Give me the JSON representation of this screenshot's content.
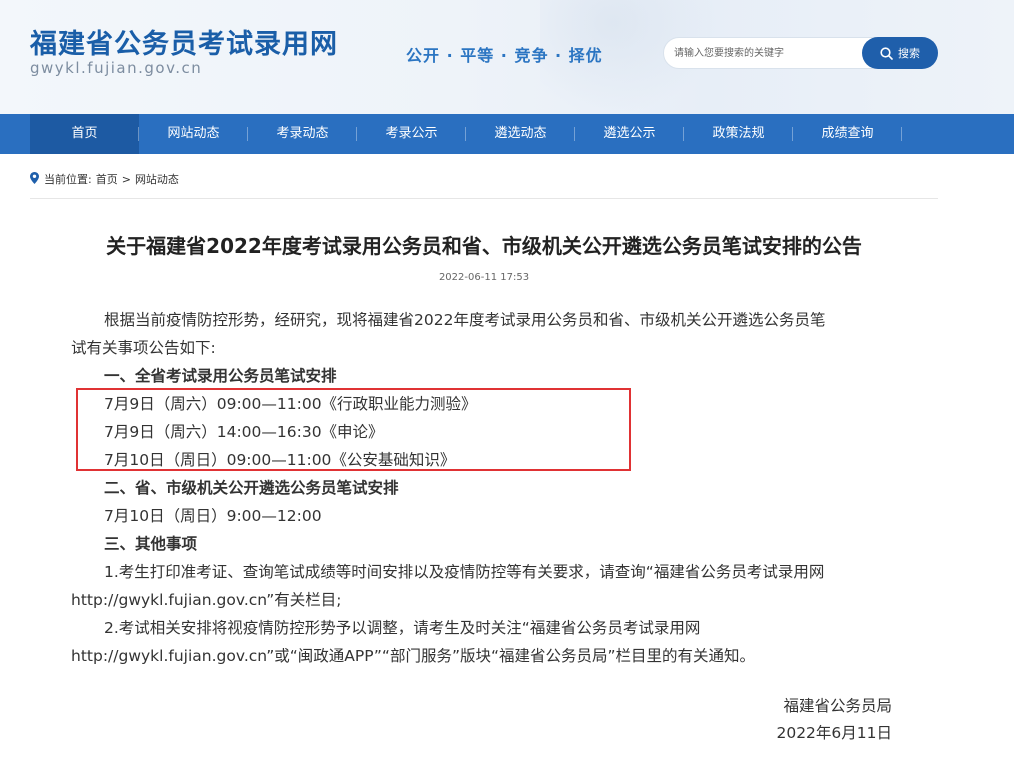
{
  "header": {
    "site_title": "福建省公务员考试录用网",
    "site_domain": "gwykl.fujian.gov.cn",
    "slogan": "公开 · 平等 · 竞争 · 择优",
    "search_placeholder": "请输入您要搜索的关键字",
    "search_button": "搜索"
  },
  "nav": {
    "items": [
      {
        "label": "首页",
        "active": true
      },
      {
        "label": "网站动态"
      },
      {
        "label": "考录动态"
      },
      {
        "label": "考录公示"
      },
      {
        "label": "遴选动态"
      },
      {
        "label": "遴选公示"
      },
      {
        "label": "政策法规"
      },
      {
        "label": "成绩查询"
      }
    ]
  },
  "breadcrumb": {
    "prefix": "当前位置:",
    "home": "首页",
    "separator": ">",
    "current": "网站动态"
  },
  "article": {
    "title": "关于福建省2022年度考试录用公务员和省、市级机关公开遴选公务员笔试安排的公告",
    "date": "2022-06-11 17:53",
    "intro_line1": "根据当前疫情防控形势，经研究，现将福建省2022年度考试录用公务员和省、市级机关公开遴选公务员笔",
    "intro_line2": "试有关事项公告如下:",
    "section1_heading": "一、全省考试录用公务员笔试安排",
    "section1_items": [
      "7月9日（周六）09:00—11:00《行政职业能力测验》",
      "7月9日（周六）14:00—16:30《申论》",
      "7月10日（周日）09:00—11:00《公安基础知识》"
    ],
    "section2_heading": "二、省、市级机关公开遴选公务员笔试安排",
    "section2_item": "7月10日（周日）9:00—12:00",
    "section3_heading": "三、其他事项",
    "item1_line1": "1.考生打印准考证、查询笔试成绩等时间安排以及疫情防控等有关要求，请查询“福建省公务员考试录用网",
    "item1_line2": "http://gwykl.fujian.gov.cn”有关栏目;",
    "item2_line1": "2.考试相关安排将视疫情防控形势予以调整，请考生及时关注“福建省公务员考试录用网",
    "item2_line2": "http://gwykl.fujian.gov.cn”或“闽政通APP”“部门服务”版块“福建省公务员局”栏目里的有关通知。",
    "sign_org": "福建省公务员局",
    "sign_date": "2022年6月11日"
  },
  "colors": {
    "brand_blue": "#1a5ea8",
    "nav_blue": "#2a6fc0",
    "nav_active": "#1d5aa3",
    "highlight_red": "#e03234"
  }
}
